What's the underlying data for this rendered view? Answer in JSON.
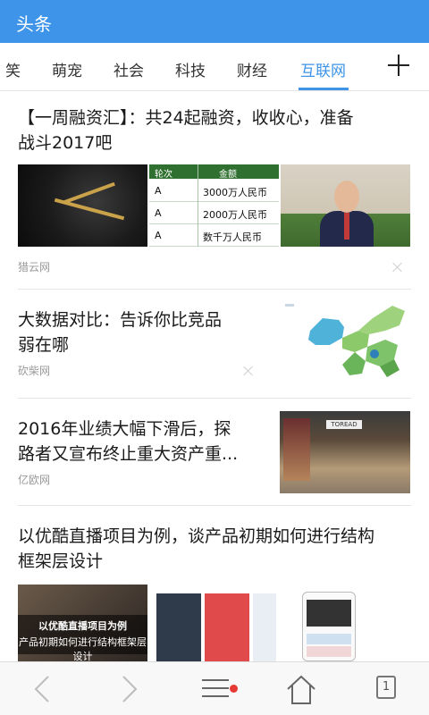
{
  "appbar": {
    "title": "头条"
  },
  "tabs": [
    {
      "label": "笑",
      "active": false
    },
    {
      "label": "萌宠",
      "active": false
    },
    {
      "label": "社会",
      "active": false
    },
    {
      "label": "科技",
      "active": false
    },
    {
      "label": "财经",
      "active": false
    },
    {
      "label": "互联网",
      "active": true
    }
  ],
  "add_tab_icon": "plus-icon",
  "articles": [
    {
      "headline_line1": "【一周融资汇】：共24起融资，收收心，准备",
      "headline_line2": "战斗2017吧",
      "source": "猎云网",
      "image_table": {
        "headers": [
          "轮次",
          "金额"
        ],
        "rows": [
          [
            "A",
            "3000万人民币"
          ],
          [
            "A",
            "2000万人民币"
          ],
          [
            "A",
            "数千万人民币"
          ]
        ]
      }
    },
    {
      "headline_line1": "大数据对比：告诉你比竞品",
      "headline_line2": "弱在哪",
      "source": "砍柴网"
    },
    {
      "headline_line1": "2016年业绩大幅下滑后，探",
      "headline_line2": "路者又宣布终止重大资产重...",
      "source": "亿欧网",
      "store_sign": "TOREAD"
    },
    {
      "headline_line1": "以优酷直播项目为例，谈产品初期如何进行结构",
      "headline_line2": "框架层设计",
      "image_caption_line1": "以优酷直播项目为例",
      "image_caption_line2": "产品初期如何进行结构框架层设计"
    }
  ],
  "bottom_nav": {
    "back_icon": "chevron-left-icon",
    "forward_icon": "chevron-right-icon",
    "menu_icon": "menu-icon",
    "home_icon": "home-icon",
    "tab_count": "1"
  },
  "colors": {
    "accent": "#3d94e8",
    "notification_dot": "#e53935"
  }
}
